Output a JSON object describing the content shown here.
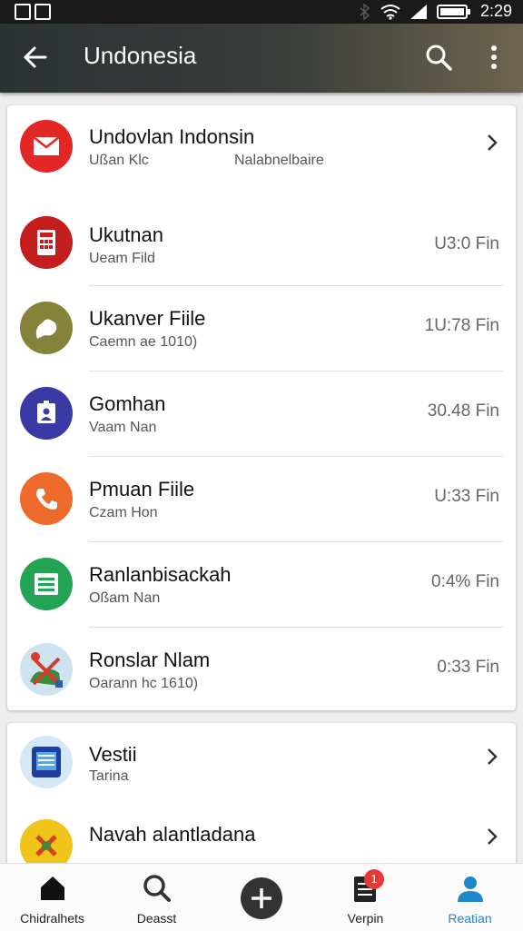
{
  "status_bar": {
    "time": "2:29"
  },
  "app_bar": {
    "title": "Undonesia"
  },
  "list1": [
    {
      "title": "Undovlan Indonsin",
      "subtitle": "Ußan Klc",
      "extra": "Nalabnelbaire",
      "trailing": "chevron",
      "icon": "mail-icon",
      "color": "#e32727"
    },
    {
      "title": "Ukutnan",
      "subtitle": "Ueam Fild",
      "time": "U3:0 Fin",
      "icon": "calculator-icon",
      "color": "#c41d1d"
    },
    {
      "title": "Ukanver Fiile",
      "subtitle": "Caemn ae 1010)",
      "time": "1U:78 Fin",
      "icon": "chat-icon",
      "color": "#85823a"
    },
    {
      "title": "Gomhan",
      "subtitle": "Vaam Nan",
      "time": "30.48 Fin",
      "icon": "contact-badge-icon",
      "color": "#3a3aa5"
    },
    {
      "title": "Pmuan Fiile",
      "subtitle": "Czam Hon",
      "time": "U:33 Fin",
      "icon": "phone-icon",
      "color": "#ee6a2a"
    },
    {
      "title": "Ranlanbisackah",
      "subtitle": "Oßam Nan",
      "time": "0:4% Fin",
      "icon": "sheets-icon",
      "color": "#23a455"
    },
    {
      "title": "Ronslar Nlam",
      "subtitle": "Oarann hc 1610)",
      "time": "0:33 Fin",
      "icon": "map-icon",
      "color": "#cde3f0"
    }
  ],
  "list2": [
    {
      "title": "Vestii",
      "subtitle": "Tarina",
      "icon": "tablet-app-icon",
      "color": "#d5e8f5"
    },
    {
      "title": "Navah alantladana",
      "subtitle": "",
      "icon": "puzzle-app-icon",
      "color": "#f0c419"
    }
  ],
  "bottom_nav": [
    {
      "label": "Chidralhets",
      "icon": "home-icon"
    },
    {
      "label": "Deasst",
      "icon": "search-icon"
    },
    {
      "label": "",
      "icon": "add-icon"
    },
    {
      "label": "Verpin",
      "icon": "list-icon",
      "badge": "1"
    },
    {
      "label": "Reatian",
      "icon": "person-icon"
    }
  ],
  "colors": {
    "accent": "#1e88c8",
    "appbar": "#2c3134"
  }
}
